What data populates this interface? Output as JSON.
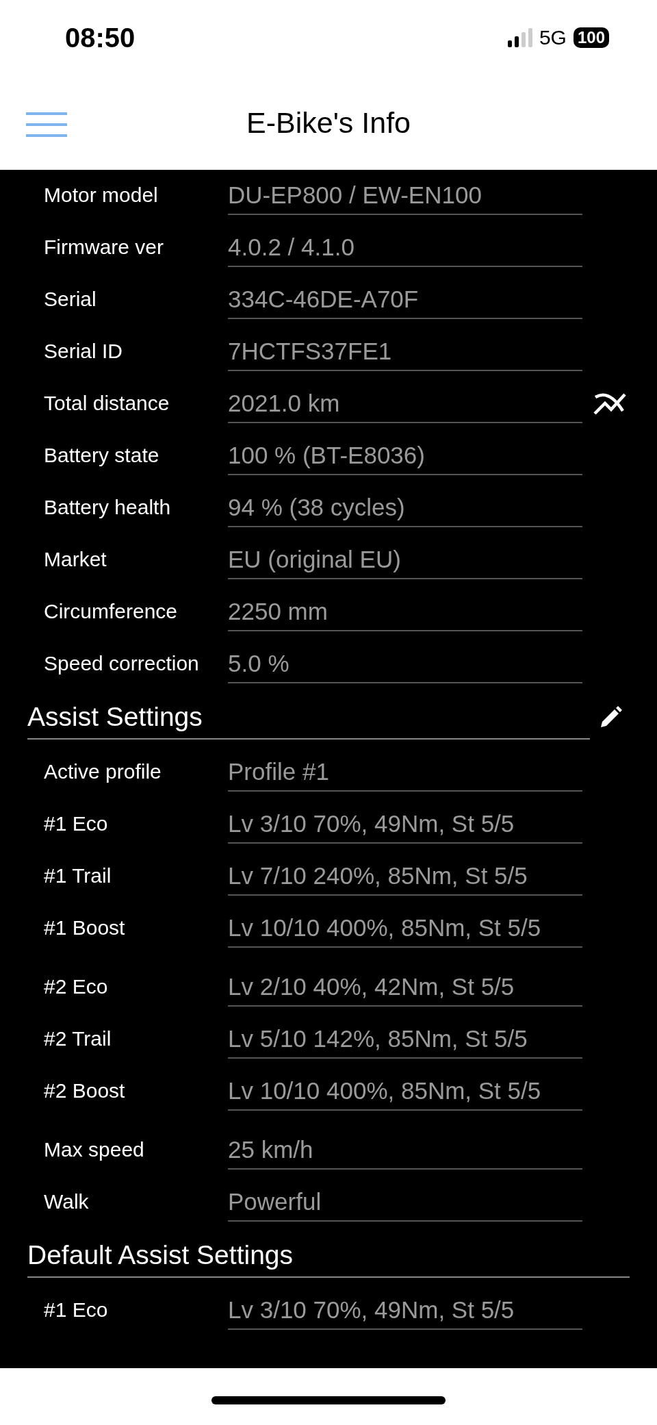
{
  "status_bar": {
    "time": "08:50",
    "network": "5G",
    "battery": "100"
  },
  "header": {
    "title": "E-Bike's Info"
  },
  "sections": [
    {
      "groups": [
        [
          {
            "label": "Motor model",
            "value": "DU-EP800 / EW-EN100",
            "kind": "plain"
          },
          {
            "label": "Firmware ver",
            "value": "4.0.2 / 4.1.0",
            "kind": "plain"
          },
          {
            "label": "Serial",
            "value": "334C-46DE-A70F",
            "kind": "plain"
          },
          {
            "label": "Serial ID",
            "value": "7HCTFS37FE1",
            "kind": "plain"
          },
          {
            "label": "Total distance",
            "value": "2021.0 km",
            "kind": "action"
          },
          {
            "label": "Battery state",
            "value": "100 % (BT-E8036)",
            "kind": "plain"
          },
          {
            "label": "Battery health",
            "value": "94 % (38 cycles)",
            "kind": "plain"
          },
          {
            "label": "Market",
            "value": "EU (original EU)",
            "kind": "plain"
          },
          {
            "label": "Circumference",
            "value": "2250 mm",
            "kind": "plain"
          },
          {
            "label": "Speed correction",
            "value": "5.0 %",
            "kind": "plain"
          }
        ]
      ]
    },
    {
      "title": "Assist Settings",
      "editable": true,
      "groups": [
        [
          {
            "label": "Active profile",
            "value": "Profile #1",
            "kind": "plain"
          },
          {
            "label": "#1 Eco",
            "value": "Lv 3/10 70%, 49Nm, St 5/5",
            "kind": "plain"
          },
          {
            "label": "#1 Trail",
            "value": "Lv 7/10 240%, 85Nm, St 5/5",
            "kind": "plain"
          },
          {
            "label": "#1 Boost",
            "value": "Lv 10/10 400%, 85Nm, St 5/5",
            "kind": "plain"
          }
        ],
        [
          {
            "label": "#2 Eco",
            "value": "Lv 2/10 40%, 42Nm, St 5/5",
            "kind": "plain"
          },
          {
            "label": "#2 Trail",
            "value": "Lv 5/10 142%, 85Nm, St 5/5",
            "kind": "plain"
          },
          {
            "label": "#2 Boost",
            "value": "Lv 10/10 400%, 85Nm, St 5/5",
            "kind": "plain"
          }
        ],
        [
          {
            "label": "Max speed",
            "value": "25 km/h",
            "kind": "plain"
          },
          {
            "label": "Walk",
            "value": "Powerful",
            "kind": "plain"
          }
        ]
      ]
    },
    {
      "title": "Default Assist Settings",
      "editable": false,
      "groups": [
        [
          {
            "label": "#1 Eco",
            "value": "Lv 3/10 70%, 49Nm, St 5/5",
            "kind": "plain"
          }
        ]
      ]
    }
  ]
}
